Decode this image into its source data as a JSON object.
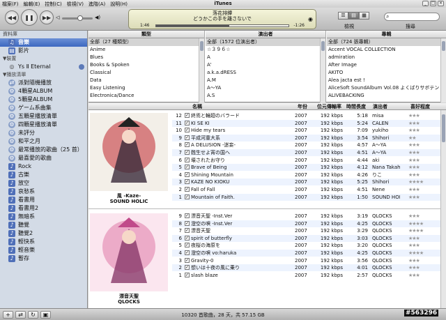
{
  "menu": [
    "檔案(F)",
    "編輯(E)",
    "控制(C)",
    "檢視(V)",
    "進階(A)",
    "說明(H)"
  ],
  "window_title": "iTunes",
  "now_playing": {
    "title": "落花排鐔",
    "subtitle": "どうかこの手を離さないで",
    "elapsed": "1:46",
    "remaining": "-1:26",
    "progress": 0.55
  },
  "volume": 0.6,
  "view_label": "檢視",
  "search_label": "搜尋",
  "sidebar": {
    "library_header": "資料庫",
    "library": [
      {
        "label": "音樂",
        "icon": "music-note-icon",
        "selected": true
      },
      {
        "label": "影片",
        "icon": "film-icon",
        "selected": false
      }
    ],
    "devices_header": "▼裝置",
    "devices": [
      {
        "label": "Ys Ⅱ Eternal",
        "icon": "cd-icon"
      }
    ],
    "playlists_header": "▼播放清單",
    "playlists": [
      {
        "label": "派對隨機播放",
        "icon": "party-shuffle-icon",
        "kind": "gear"
      },
      {
        "label": "4顆星ALBUM",
        "icon": "smart-playlist-icon",
        "kind": "gear"
      },
      {
        "label": "5顆星ALBUM",
        "icon": "smart-playlist-icon",
        "kind": "gear"
      },
      {
        "label": "ゲーム系曲集",
        "icon": "smart-playlist-icon",
        "kind": "gear"
      },
      {
        "label": "五顆星播放清單",
        "icon": "smart-playlist-icon",
        "kind": "gear"
      },
      {
        "label": "四顆星播放清單",
        "icon": "smart-playlist-icon",
        "kind": "gear"
      },
      {
        "label": "未評分",
        "icon": "smart-playlist-icon",
        "kind": "gear"
      },
      {
        "label": "和平之月",
        "icon": "smart-playlist-icon",
        "kind": "gear"
      },
      {
        "label": "最常播放的歌曲（25 首）",
        "icon": "smart-playlist-icon",
        "kind": "gear"
      },
      {
        "label": "最喜愛的歌曲",
        "icon": "smart-playlist-icon",
        "kind": "gear"
      },
      {
        "label": "Rock",
        "icon": "playlist-icon",
        "kind": "blue"
      },
      {
        "label": "古樂",
        "icon": "playlist-icon",
        "kind": "blue"
      },
      {
        "label": "放空",
        "icon": "playlist-icon",
        "kind": "blue"
      },
      {
        "label": "哀愁系",
        "icon": "playlist-icon",
        "kind": "blue"
      },
      {
        "label": "看書用",
        "icon": "playlist-icon",
        "kind": "blue"
      },
      {
        "label": "看書用2",
        "icon": "playlist-icon",
        "kind": "blue"
      },
      {
        "label": "無暗系",
        "icon": "playlist-icon",
        "kind": "blue"
      },
      {
        "label": "聽覺",
        "icon": "playlist-icon",
        "kind": "blue"
      },
      {
        "label": "聽覺2",
        "icon": "playlist-icon",
        "kind": "blue"
      },
      {
        "label": "輕快系",
        "icon": "playlist-icon",
        "kind": "blue"
      },
      {
        "label": "輕音樂",
        "icon": "playlist-icon",
        "kind": "blue"
      },
      {
        "label": "暫存",
        "icon": "playlist-icon",
        "kind": "blue"
      }
    ]
  },
  "browser": {
    "genre": {
      "header": "類型",
      "rows": [
        "全部（27 種類型）",
        "Anime",
        "Blues",
        "Books & Spoken",
        "Classical",
        "Data",
        "Easy Listening",
        "Electronica/Dance"
      ]
    },
    "artist": {
      "header": "演出者",
      "rows": [
        "全部（1572 位演出者）",
        "☆３９６☆",
        "A",
        "A'",
        "a.k.a.dRESS",
        "A.M",
        "A～YA",
        "A.S"
      ]
    },
    "album": {
      "header": "專輯",
      "rows": [
        "全部（724 張專輯）",
        "Accent VOCAL COLLECTION",
        "admiration",
        "After Image",
        "AKITO",
        "Alea jacta est !",
        "AliceSoft SoundAlbum Vol.08 よくばりサボテン",
        "ALIVEBACKING"
      ]
    }
  },
  "columns": {
    "name": "名稱",
    "year": "年份",
    "bitrate": "位元傳輸率",
    "time": "時間長度",
    "artist": "演出者",
    "rating": "喜好程度"
  },
  "album_groups": [
    {
      "caption1": "風 -Kaze-",
      "caption2": "SOUND HOLIC",
      "cover_color": "#c0262e",
      "tracks": [
        {
          "no": "12",
          "name": "終焉と輪廻のバラード",
          "year": "2007",
          "bitrate": "192 kbps",
          "time": "5:18",
          "artist": "misa",
          "rating": "★★★"
        },
        {
          "no": "11",
          "name": "KI SE KI",
          "year": "2007",
          "bitrate": "192 kbps",
          "time": "5:24",
          "artist": "CALEN",
          "rating": "★★★"
        },
        {
          "no": "10",
          "name": "Hide my tears",
          "year": "2007",
          "bitrate": "192 kbps",
          "time": "7:09",
          "artist": "yukiho",
          "rating": "★★★"
        },
        {
          "no": "9",
          "name": "平成河童大系",
          "year": "2007",
          "bitrate": "192 kbps",
          "time": "3:54",
          "artist": "Shihori",
          "rating": "★★"
        },
        {
          "no": "8",
          "name": "A DELUSION -迷妄-",
          "year": "2007",
          "bitrate": "192 kbps",
          "time": "4:57",
          "artist": "A～YA",
          "rating": "★★★"
        },
        {
          "no": "7",
          "name": "甦生せよ宵の国へ",
          "year": "2007",
          "bitrate": "192 kbps",
          "time": "4:51",
          "artist": "A～YA",
          "rating": "★★★"
        },
        {
          "no": "6",
          "name": "壊されたお守り",
          "year": "2007",
          "bitrate": "192 kbps",
          "time": "4:44",
          "artist": "aki",
          "rating": "★★★"
        },
        {
          "no": "5",
          "name": "Brave of Being",
          "year": "2007",
          "bitrate": "192 kbps",
          "time": "4:12",
          "artist": "Nana Takahashi",
          "rating": "★★★"
        },
        {
          "no": "4",
          "name": "Shining Mountain",
          "year": "2007",
          "bitrate": "192 kbps",
          "time": "4:26",
          "artist": "りこ",
          "rating": "★★★"
        },
        {
          "no": "3",
          "name": "KAZE NO KIOKU",
          "year": "2007",
          "bitrate": "192 kbps",
          "time": "5:25",
          "artist": "Shihori",
          "rating": "★★★★"
        },
        {
          "no": "2",
          "name": "Fall of Fall",
          "year": "2007",
          "bitrate": "192 kbps",
          "time": "4:51",
          "artist": "Nene",
          "rating": "★★★"
        },
        {
          "no": "1",
          "name": "Mountain of Faith.",
          "year": "2007",
          "bitrate": "192 kbps",
          "time": "1:50",
          "artist": "SOUND HOLIC",
          "rating": "★★★"
        }
      ]
    },
    {
      "caption1": "漂音天聖",
      "caption2": "QLOCKS",
      "cover_color": "#e07aa8",
      "tracks": [
        {
          "no": "9",
          "name": "漂音天聖 -Inst.Ver",
          "year": "2007",
          "bitrate": "192 kbps",
          "time": "3:19",
          "artist": "QLOCKS",
          "rating": "★★★"
        },
        {
          "no": "8",
          "name": "澄空の唄 -Inst.Ver",
          "year": "2007",
          "bitrate": "192 kbps",
          "time": "4:25",
          "artist": "QLOCKS",
          "rating": "★★★★"
        },
        {
          "no": "7",
          "name": "漂音天聖",
          "year": "2007",
          "bitrate": "192 kbps",
          "time": "3:29",
          "artist": "QLOCKS",
          "rating": "★★★★"
        },
        {
          "no": "6",
          "name": "spirit of butterfly",
          "year": "2007",
          "bitrate": "192 kbps",
          "time": "3:03",
          "artist": "QLOCKS",
          "rating": "★★★"
        },
        {
          "no": "5",
          "name": "夜桜の海原を",
          "year": "2007",
          "bitrate": "192 kbps",
          "time": "3:20",
          "artist": "QLOCKS",
          "rating": "★★★"
        },
        {
          "no": "4",
          "name": "澄空の唄 vo:haruka",
          "year": "2007",
          "bitrate": "192 kbps",
          "time": "4:25",
          "artist": "QLOCKS",
          "rating": "★★★★"
        },
        {
          "no": "3",
          "name": "Gravity-0",
          "year": "2007",
          "bitrate": "192 kbps",
          "time": "3:56",
          "artist": "QLOCKS",
          "rating": "★★★"
        },
        {
          "no": "2",
          "name": "想いは十夜の風に乗り",
          "year": "2007",
          "bitrate": "192 kbps",
          "time": "4:01",
          "artist": "QLOCKS",
          "rating": "★★★"
        },
        {
          "no": "1",
          "name": "slash blaze",
          "year": "2007",
          "bitrate": "192 kbps",
          "time": "2:57",
          "artist": "QLOCKS",
          "rating": "★★★"
        }
      ]
    }
  ],
  "status_text": "10320 首歌曲，28 天，共 57.15 GB",
  "watermark": "#563296"
}
